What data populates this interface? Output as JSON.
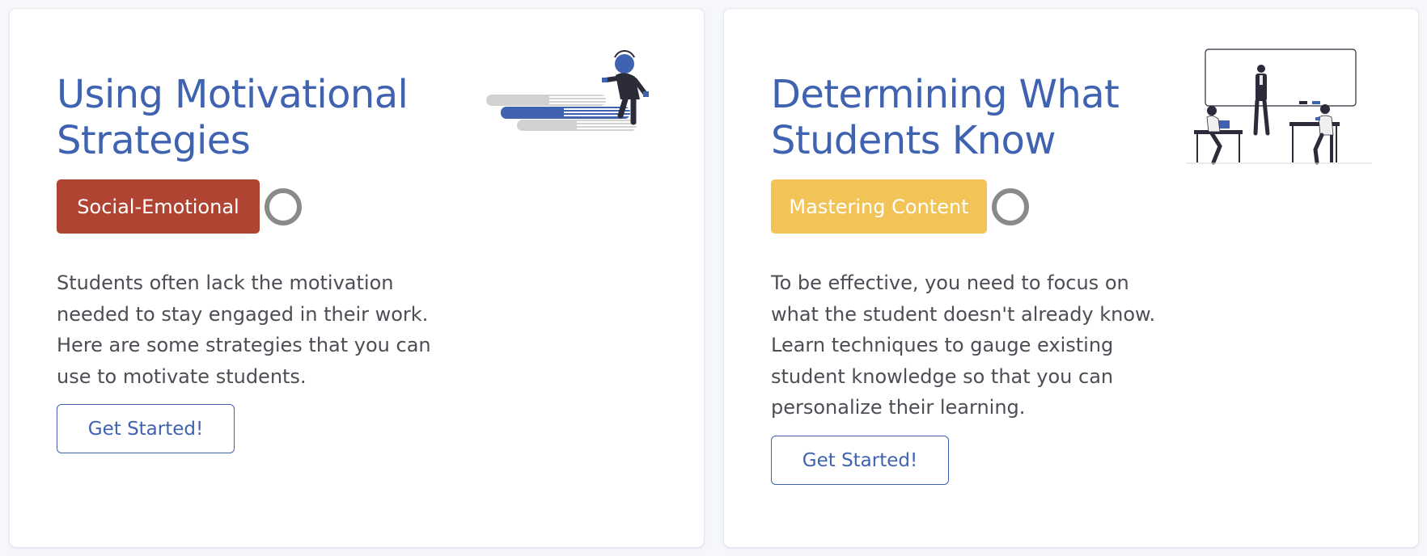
{
  "colors": {
    "title": "#3f63b0",
    "button_text": "#3f63b0",
    "social_emotional": "#b04433",
    "mastering_content": "#f2c357",
    "description": "#4d4d55",
    "status_ring": "#8a8a8a"
  },
  "cards": [
    {
      "title": "Using Motivational Strategies",
      "tag": "Social-Emotional",
      "description": "Students often lack the motivation needed to stay engaged in their work. Here are some strategies that you can use to motivate students.",
      "button": "Get Started!",
      "illustration": "person-climbing-books-illustration"
    },
    {
      "title": "Determining What Students Know",
      "tag": "Mastering Content",
      "description": "To be effective, you need to focus on what the student doesn't already know. Learn techniques to gauge existing student knowledge so that you can personalize their learning.",
      "button": "Get Started!",
      "illustration": "classroom-teacher-students-illustration"
    }
  ]
}
